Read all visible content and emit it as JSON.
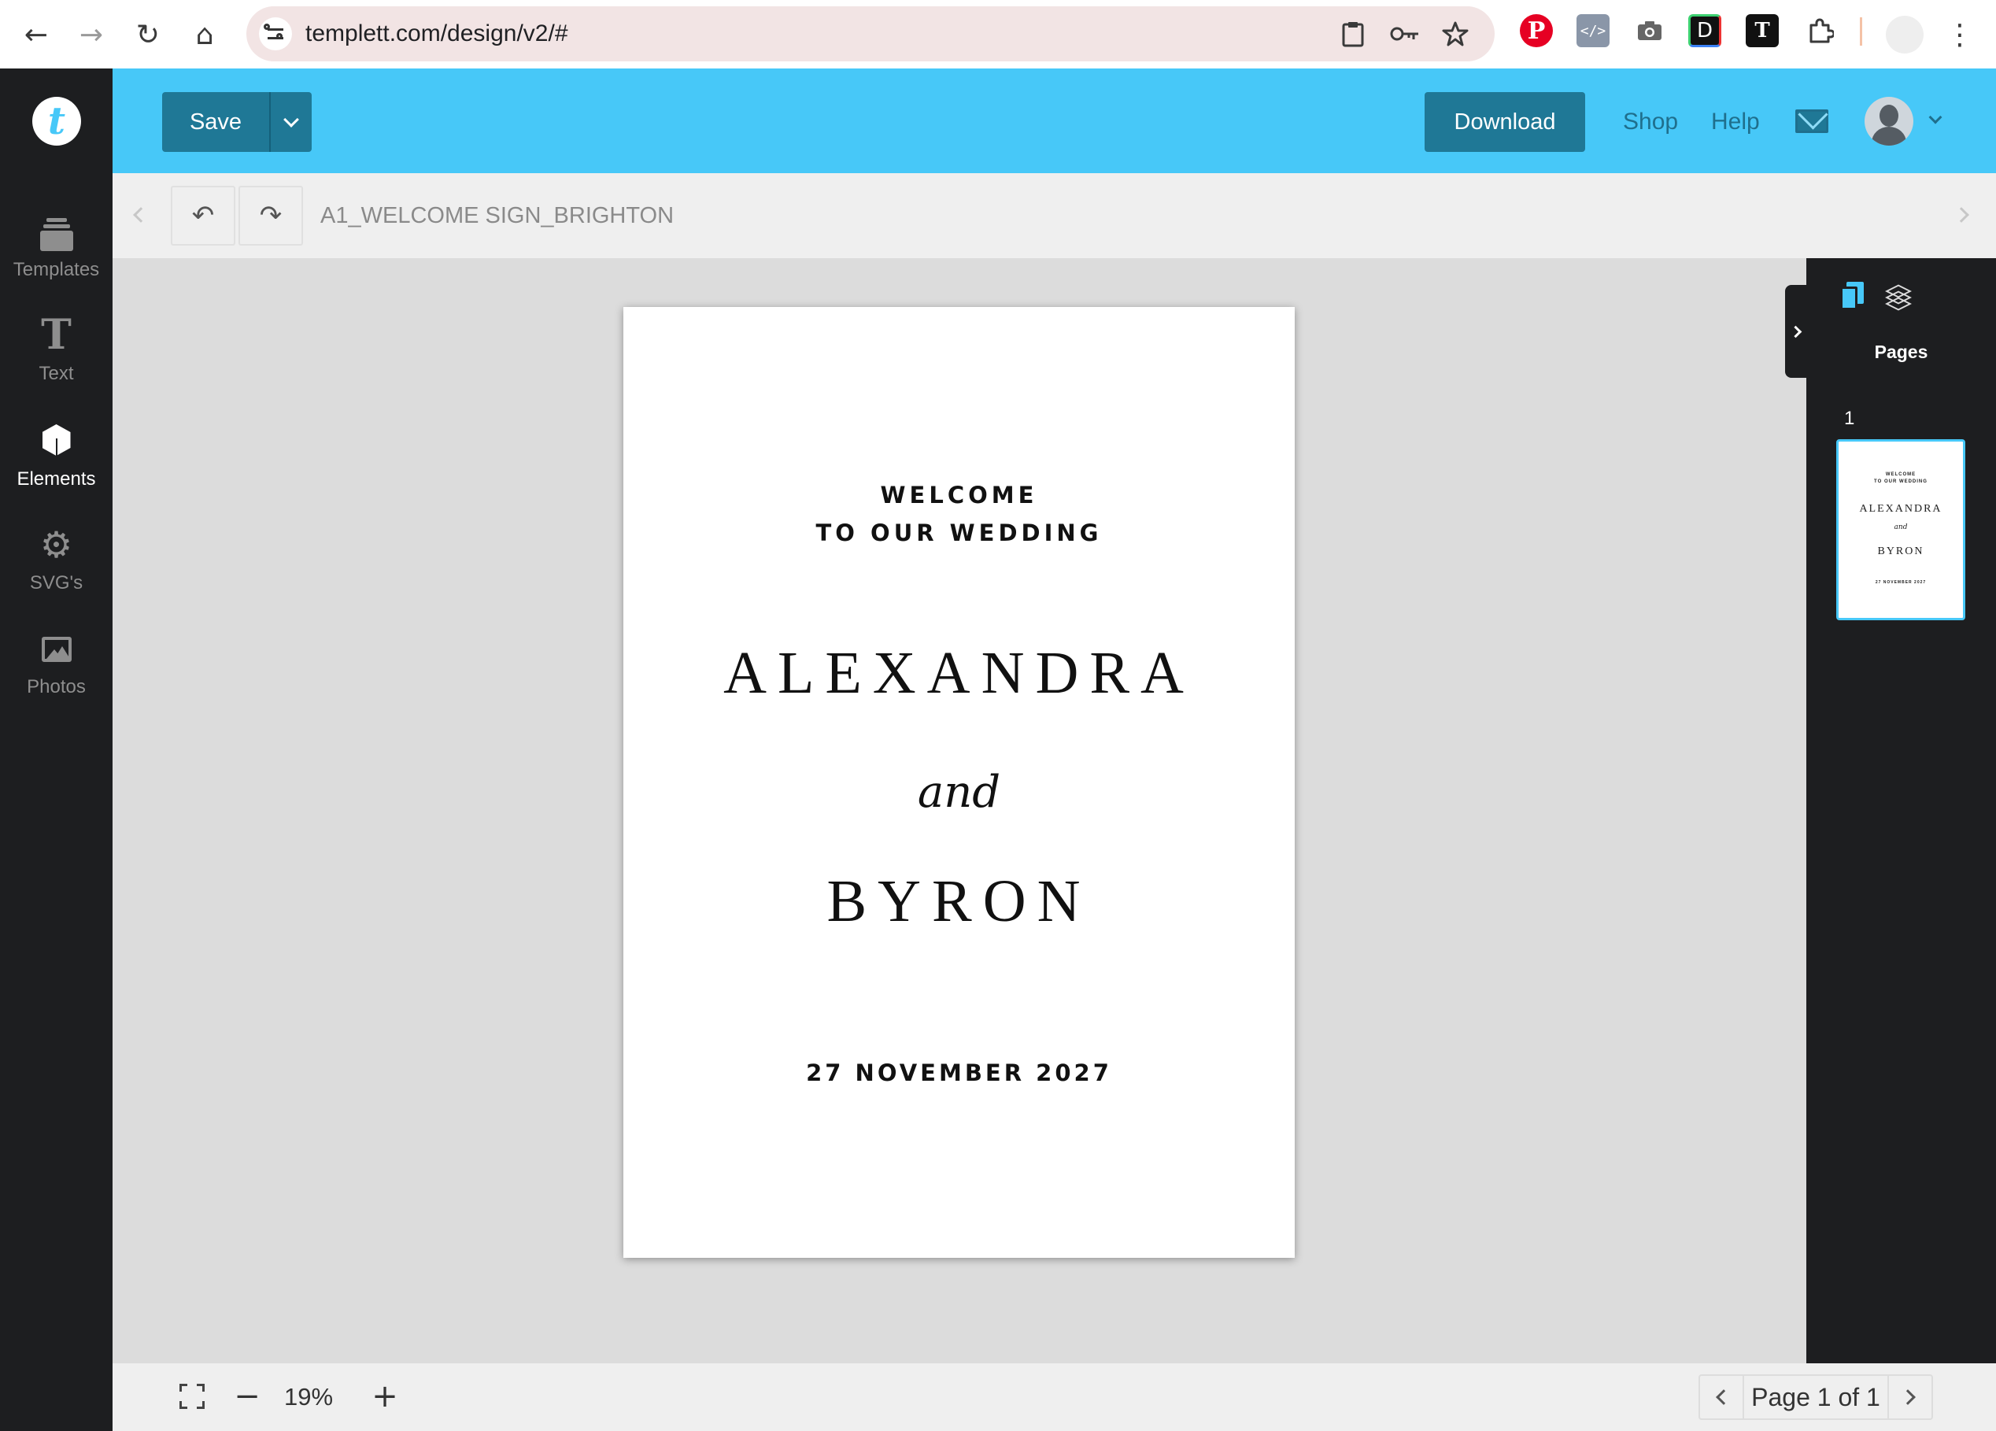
{
  "browser": {
    "url": "templett.com/design/v2/#",
    "back_glyph": "←",
    "forward_glyph": "→",
    "reload_glyph": "↻",
    "home_glyph": "⌂",
    "menu_glyph": "⋮",
    "extensions": [
      {
        "name": "pinterest-extension",
        "glyph": "P"
      },
      {
        "name": "dev-tools-extension",
        "glyph": "</>"
      },
      {
        "name": "screenshot-extension",
        "glyph": "📷"
      },
      {
        "name": "color-extension",
        "glyph": "D"
      },
      {
        "name": "text-extension",
        "glyph": "T"
      },
      {
        "name": "extensions-puzzle",
        "glyph": "⧉"
      }
    ]
  },
  "app": {
    "logo_letter": "t",
    "accent_color": "#47c8f8",
    "button_color": "#1f7896",
    "header": {
      "save_label": "Save",
      "download_label": "Download",
      "shop_label": "Shop",
      "help_label": "Help"
    }
  },
  "sidebar": {
    "items": [
      {
        "label": "Templates",
        "icon": "templates-icon",
        "active": false
      },
      {
        "label": "Text",
        "icon": "text-icon",
        "active": false
      },
      {
        "label": "Elements",
        "icon": "cube-icon",
        "active": true
      },
      {
        "label": "SVG's",
        "icon": "gear-icon",
        "active": false
      },
      {
        "label": "Photos",
        "icon": "photos-icon",
        "active": false
      }
    ],
    "text_glyph": "T",
    "svg_glyph": "⚙"
  },
  "toolbar": {
    "undo_glyph": "↶",
    "redo_glyph": "↷",
    "document_name": "A1_WELCOME SIGN_BRIGHTON"
  },
  "design": {
    "welcome_line1": "WELCOME",
    "welcome_line2": "TO OUR WEDDING",
    "name1": "ALEXANDRA",
    "conjunction": "and",
    "name2": "BYRON",
    "date": "27 NOVEMBER 2027"
  },
  "right_panel": {
    "heading": "Pages",
    "page_number": "1"
  },
  "bottom_bar": {
    "zoom_out_glyph": "−",
    "zoom_in_glyph": "+",
    "zoom": "19%",
    "page_indicator": "Page 1 of 1"
  }
}
